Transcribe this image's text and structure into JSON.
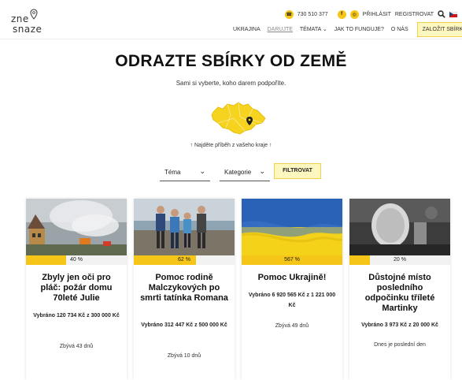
{
  "header": {
    "logo_top": "zne",
    "logo_bottom": "snaze",
    "phone": "730 510 377",
    "login": "PŘIHLÁSIT",
    "register": "REGISTROVAT",
    "nav": [
      "UKRAJINA",
      "DARUJTE",
      "TÉMATA",
      "JAK TO FUNGUJE?",
      "O NÁS"
    ],
    "cta": "ZALOŽIT SBÍRKU"
  },
  "hero": {
    "title": "ODRAZTE SBÍRKY OD ZEMĚ",
    "subtitle": "Sami si vyberte, koho darem podpoříte.",
    "region_hint": "↑ Najděte příběh z vašeho kraje ↑"
  },
  "filters": {
    "theme": "Téma",
    "category": "Kategorie",
    "button": "FILTROVAT"
  },
  "cards": [
    {
      "percent_label": "40 %",
      "progress": 0.4,
      "title": "Zbyly jen oči pro pláč: požár domu 70leté Julie",
      "raised": "Vybráno 120 734 Kč z 300 000 Kč",
      "remaining": "Zbývá 43 dnů"
    },
    {
      "percent_label": "62 %",
      "progress": 0.62,
      "title": "Pomoc rodině Malczykových po smrti tatínka Romana",
      "raised": "Vybráno 312 447 Kč z 500 000 Kč",
      "remaining": "Zbývá 10 dnů"
    },
    {
      "percent_label": "567 %",
      "progress": 1.0,
      "title": "Pomoc Ukrajině!",
      "raised": "Vybráno 6 920 565 Kč z 1 221 000 Kč",
      "remaining": "Zbývá 49 dnů"
    },
    {
      "percent_label": "20 %",
      "progress": 0.2,
      "title": "Důstojné místo posledního odpočinku tříleté Martinky",
      "raised": "Vybráno 3 973 Kč z 20 000 Kč",
      "remaining": "Dnes je poslední den"
    }
  ],
  "colors": {
    "accent": "#f5c518",
    "cta_bg": "#fff7c0"
  }
}
